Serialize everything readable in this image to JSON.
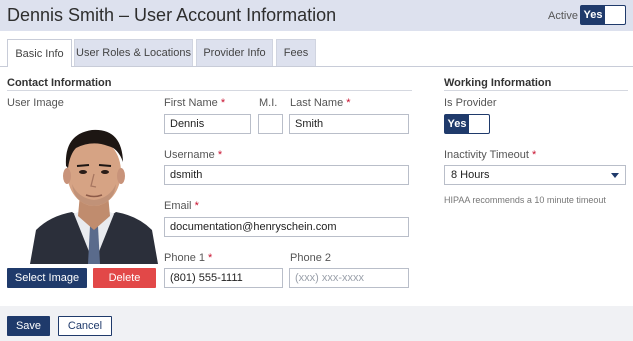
{
  "header": {
    "title": "Dennis Smith – User Account Information",
    "active_label": "Active",
    "active_toggle": "Yes"
  },
  "tabs": [
    {
      "label": "Basic Info",
      "active": true
    },
    {
      "label": "User Roles & Locations",
      "active": false
    },
    {
      "label": "Provider Info",
      "active": false
    },
    {
      "label": "Fees",
      "active": false
    }
  ],
  "contact": {
    "section_title": "Contact Information",
    "user_image_label": "User Image",
    "first_name": {
      "label": "First Name",
      "value": "Dennis"
    },
    "mi": {
      "label": "M.I.",
      "value": ""
    },
    "last_name": {
      "label": "Last Name",
      "value": "Smith"
    },
    "username": {
      "label": "Username",
      "value": "dsmith"
    },
    "email": {
      "label": "Email",
      "value": "documentation@henryschein.com"
    },
    "phone1": {
      "label": "Phone 1",
      "value": "(801) 555-1111"
    },
    "phone2": {
      "label": "Phone 2",
      "placeholder": "(xxx) xxx-xxxx"
    },
    "required_marker": "*",
    "select_image_label": "Select Image",
    "delete_label": "Delete"
  },
  "working": {
    "section_title": "Working Information",
    "is_provider_label": "Is Provider",
    "is_provider_toggle": "Yes",
    "inactivity_label": "Inactivity Timeout",
    "inactivity_value": "8 Hours",
    "hint": "HIPAA recommends a 10 minute timeout"
  },
  "footer": {
    "save_label": "Save",
    "cancel_label": "Cancel"
  },
  "colors": {
    "navy": "#1f3a6b",
    "delete_red": "#e24848",
    "header_bg": "#dde1ee",
    "required": "#c8102e"
  }
}
